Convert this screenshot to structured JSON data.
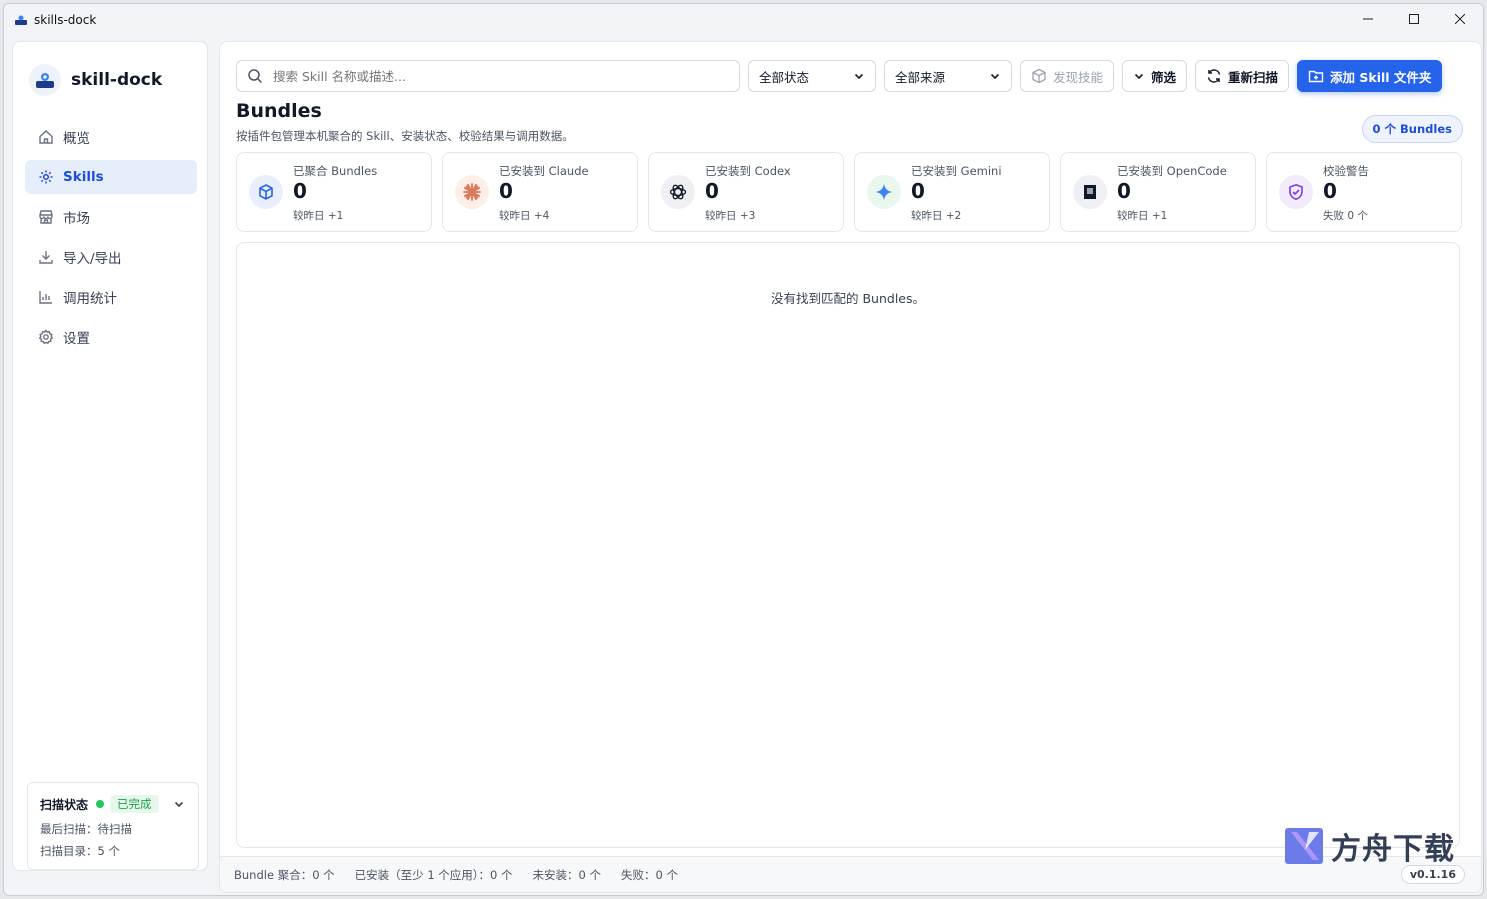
{
  "window": {
    "title": "skills-dock",
    "controls": [
      "minimize",
      "maximize",
      "close"
    ]
  },
  "sidebar": {
    "brand": "skill-dock",
    "items": [
      {
        "label": "概览",
        "icon": "home-icon",
        "active": false
      },
      {
        "label": "Skills",
        "icon": "gear-icon",
        "active": true
      },
      {
        "label": "市场",
        "icon": "store-icon",
        "active": false
      },
      {
        "label": "导入/导出",
        "icon": "download-icon",
        "active": false
      },
      {
        "label": "调用统计",
        "icon": "bar-chart-icon",
        "active": false
      },
      {
        "label": "设置",
        "icon": "settings-icon",
        "active": false
      }
    ],
    "scan": {
      "label": "扫描状态",
      "status": "已完成",
      "last_scan": "最后扫描：待扫描",
      "dirs": "扫描目录：5 个"
    }
  },
  "toolbar": {
    "search_placeholder": "搜索 Skill 名称或描述...",
    "status_select": "全部状态",
    "source_select": "全部来源",
    "discover": "发现技能",
    "filter": "筛选",
    "rescan": "重新扫描",
    "add_folder": "添加 Skill 文件夹"
  },
  "page": {
    "title": "Bundles",
    "subtitle": "按插件包管理本机聚合的 Skill、安装状态、校验结果与调用数据。",
    "count_pill": "0 个 Bundles"
  },
  "stats": [
    {
      "label": "已聚合 Bundles",
      "value": "0",
      "delta": "较昨日 +1",
      "icon": "cube-icon",
      "bg": "#e8eefb",
      "color": "#2563eb"
    },
    {
      "label": "已安装到 Claude",
      "value": "0",
      "delta": "较昨日 +4",
      "icon": "claude-icon",
      "bg": "#fdeee8",
      "color": "#d97757"
    },
    {
      "label": "已安装到 Codex",
      "value": "0",
      "delta": "较昨日 +3",
      "icon": "openai-icon",
      "bg": "#eef0f3",
      "color": "#111827"
    },
    {
      "label": "已安装到 Gemini",
      "value": "0",
      "delta": "较昨日 +2",
      "icon": "gemini-icon",
      "bg": "#e9f7ef",
      "color": "#3b82f6"
    },
    {
      "label": "已安装到 OpenCode",
      "value": "0",
      "delta": "较昨日 +1",
      "icon": "opencode-icon",
      "bg": "#eef0f3",
      "color": "#111827"
    },
    {
      "label": "校验警告",
      "value": "0",
      "delta": "失败 0 个",
      "icon": "shield-check-icon",
      "bg": "#f1ebfb",
      "color": "#7c3aed"
    }
  ],
  "empty_message": "没有找到匹配的 Bundles。",
  "statusbar": {
    "aggregated": "Bundle 聚合：0 个",
    "installed": "已安装（至少 1 个应用）：0 个",
    "not_installed": "未安装：0 个",
    "failed": "失败：0 个",
    "version": "v0.1.16"
  },
  "watermark": "方舟下载"
}
